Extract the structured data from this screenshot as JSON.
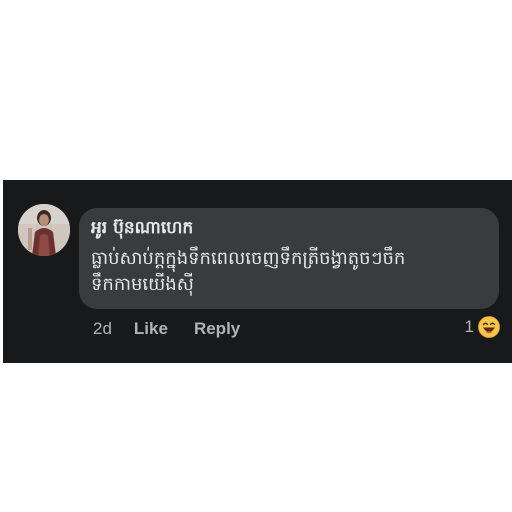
{
  "comment": {
    "author": "អូរ ប៊ុនណាហេក",
    "line1": "ធ្លាប់សាប់ក្តក្នុងទឹកពេលចេញទឹកត្រីចង្វាតូចៗចឹក",
    "line2": "ទឹកកាមយើងស៊ី",
    "time": "2d",
    "like_label": "Like",
    "reply_label": "Reply",
    "reaction_count": "1",
    "reaction_icon": "laughing-emoji-icon"
  },
  "colors": {
    "panel_bg": "#18191a",
    "bubble_bg": "#3a3b3c",
    "text": "#e4e6eb",
    "secondary_text": "#b0b3b8"
  }
}
